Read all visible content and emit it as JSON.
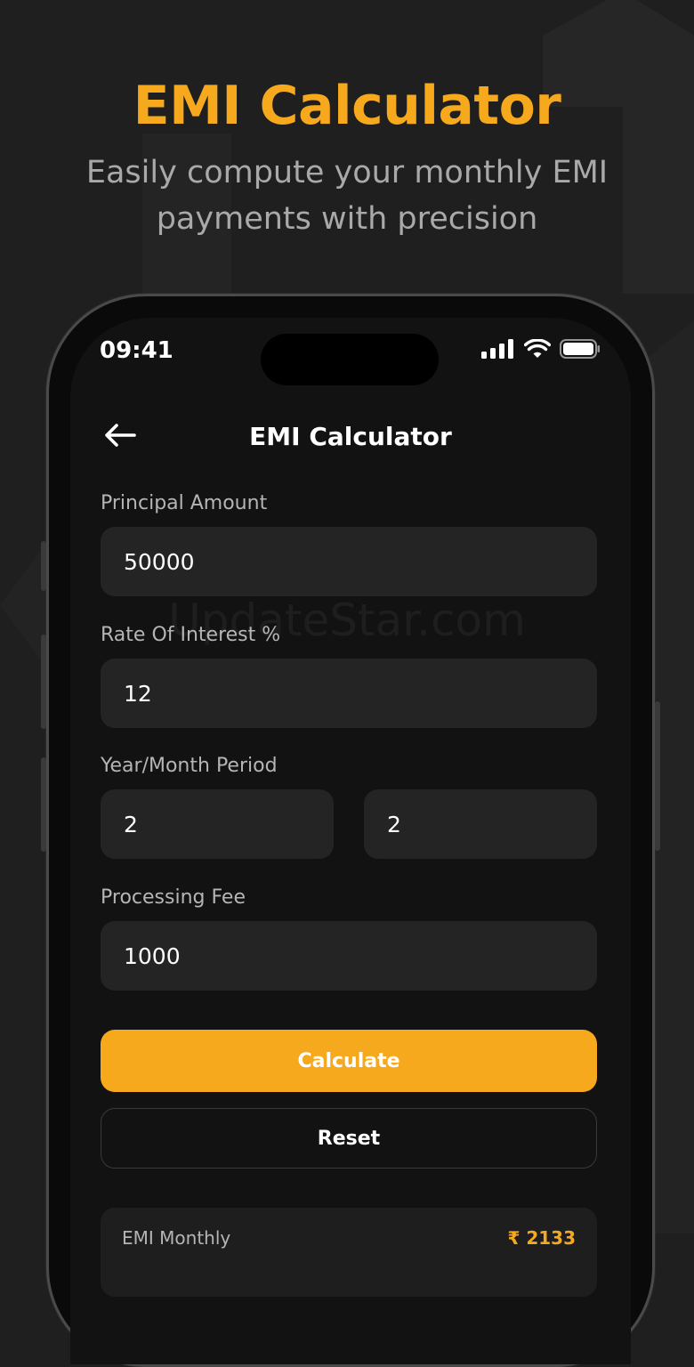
{
  "hero": {
    "title": "EMI Calculator",
    "subtitle_line1": "Easily compute your monthly EMI",
    "subtitle_line2": "payments with precision"
  },
  "status_bar": {
    "time": "09:41"
  },
  "app_bar": {
    "title": "EMI Calculator"
  },
  "form": {
    "principal_label": "Principal Amount",
    "principal_value": "50000",
    "rate_label": "Rate Of Interest %",
    "rate_value": "12",
    "period_label": "Year/Month Period",
    "period_years_value": "2",
    "period_months_value": "2",
    "fee_label": "Processing Fee",
    "fee_value": "1000"
  },
  "actions": {
    "calculate_label": "Calculate",
    "reset_label": "Reset"
  },
  "result": {
    "label": "EMI Monthly",
    "value": "₹ 2133"
  },
  "watermark": "UpdateStar.com",
  "colors": {
    "accent": "#f7a91e",
    "background": "#1f1f1f",
    "screen": "#121212",
    "input": "#242424"
  },
  "icons": {
    "back": "arrow-left-icon",
    "signal": "cellular-signal-icon",
    "wifi": "wifi-icon",
    "battery": "battery-icon"
  }
}
